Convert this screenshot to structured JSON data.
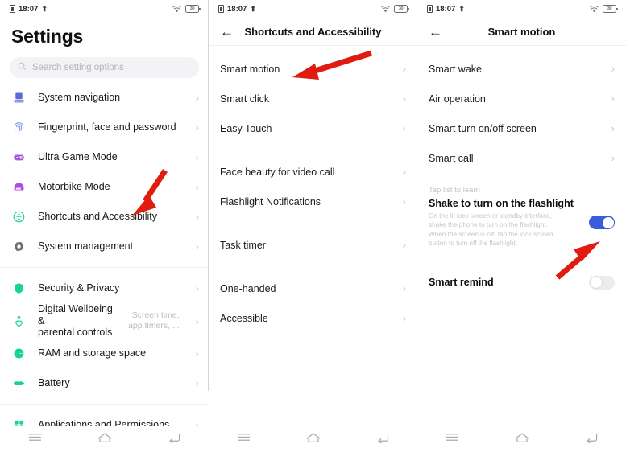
{
  "status_bar": {
    "time": "18:07",
    "sim_icon": "sim-card-icon",
    "upload_icon": "upload-arrow-icon",
    "wifi_icon": "wifi-icon",
    "battery_icon": "battery-icon",
    "battery_text": "30"
  },
  "nav_bar": {
    "recents_label": "recent-apps",
    "home_label": "home",
    "back_label": "back"
  },
  "colors": {
    "accent_green": "#16d39a",
    "toggle_on": "#3b5ddd",
    "toggle_off": "#ececef",
    "annotation_red": "#e01b10",
    "chevron": "#c9c9cf"
  },
  "panel1": {
    "title": "Settings",
    "search": {
      "placeholder": "Search setting options",
      "icon": "search-icon"
    },
    "items": [
      {
        "label": "System navigation",
        "icon": "navigation-bar-icon",
        "color": "#5b6bd6",
        "value": ""
      },
      {
        "label": "Fingerprint, face and password",
        "icon": "fingerprint-icon",
        "color": "#7d93e8",
        "value": ""
      },
      {
        "label": "Ultra Game Mode",
        "icon": "gamepad-icon",
        "color": "#a855e0",
        "value": ""
      },
      {
        "label": "Motorbike Mode",
        "icon": "helmet-icon",
        "color": "#b04ae0",
        "value": ""
      },
      {
        "label": "Shortcuts and Accessibility",
        "icon": "accessibility-icon",
        "color": "#16d39a",
        "value": ""
      },
      {
        "label": "System management",
        "icon": "gear-icon",
        "color": "#6e6e72",
        "value": ""
      }
    ],
    "items2": [
      {
        "label": "Security & Privacy",
        "icon": "shield-icon",
        "color": "#16d39a",
        "value": ""
      },
      {
        "label": "Digital Wellbeing &",
        "label2": "parental controls",
        "icon": "wellbeing-icon",
        "color": "#16d39a",
        "value": "Screen time,",
        "value2": "app timers, ..."
      },
      {
        "label": "RAM and storage space",
        "icon": "pie-chart-icon",
        "color": "#16d39a",
        "value": ""
      },
      {
        "label": "Battery",
        "icon": "battery-full-icon",
        "color": "#16d39a",
        "value": ""
      }
    ],
    "items3": [
      {
        "label": "Applications and Permissions",
        "icon": "grid-apps-icon",
        "color": "#16d39a",
        "value": ""
      }
    ]
  },
  "panel2": {
    "title": "Shortcuts and Accessibility",
    "back_icon": "back-arrow-icon",
    "groups": [
      [
        {
          "label": "Smart motion"
        },
        {
          "label": "Smart click"
        },
        {
          "label": "Easy Touch"
        }
      ],
      [
        {
          "label": "Face beauty for video call"
        },
        {
          "label": "Flashlight Notifications"
        }
      ],
      [
        {
          "label": "Task timer"
        }
      ],
      [
        {
          "label": "One-handed"
        },
        {
          "label": "Accessible"
        }
      ]
    ]
  },
  "panel3": {
    "title": "Smart motion",
    "back_icon": "back-arrow-icon",
    "items": [
      {
        "label": "Smart wake"
      },
      {
        "label": "Air operation"
      },
      {
        "label": "Smart turn on/off screen"
      },
      {
        "label": "Smart call"
      }
    ],
    "tap_hint": "Tap list to learn",
    "feature": {
      "title": "Shake to turn on the flashlight",
      "description": "On the lit lock screen or standby interface, shake the phone to turn on the flashlight.\nWhen the screen is off, tap the lock screen button to turn off the flashlight.",
      "toggle_state": "on"
    },
    "smart_remind": {
      "label": "Smart remind",
      "toggle_state": "off"
    }
  },
  "annotations": [
    {
      "name": "arrow-to-shortcuts-and-accessibility",
      "target": "Shortcuts and Accessibility"
    },
    {
      "name": "arrow-to-smart-motion",
      "target": "Smart motion"
    },
    {
      "name": "arrow-to-flashlight-toggle",
      "target": "Shake to turn on the flashlight toggle"
    }
  ]
}
